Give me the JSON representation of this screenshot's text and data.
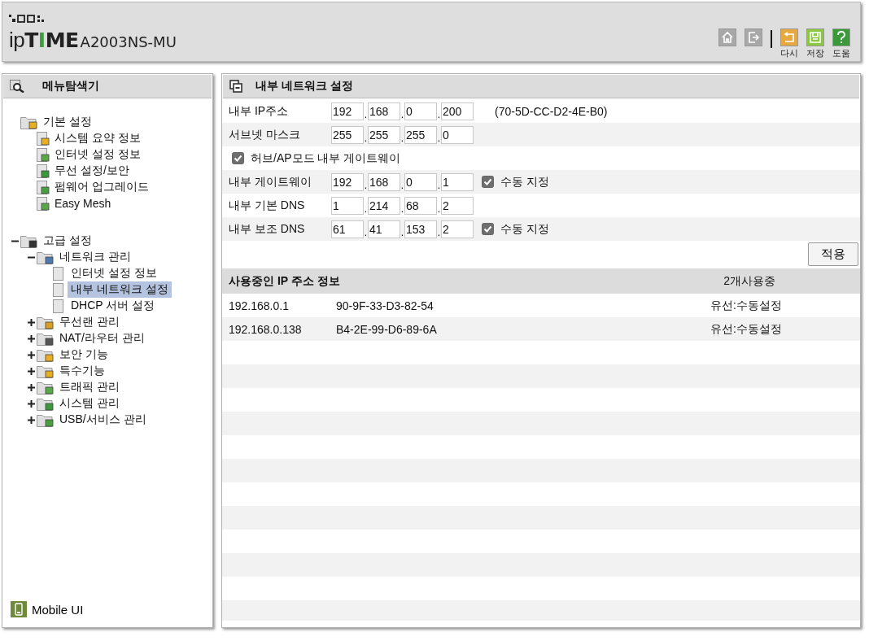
{
  "header": {
    "logo": "ipTIME",
    "model": "A2003NS-MU",
    "actions": [
      {
        "kind": "home"
      },
      {
        "kind": "logout"
      },
      {
        "kind": "undo",
        "label": "다시"
      },
      {
        "kind": "save",
        "label": "저장"
      },
      {
        "kind": "help",
        "label": "도움"
      }
    ]
  },
  "sidebar": {
    "title": "메뉴탐색기",
    "tree": [
      {
        "label": "기본 설정",
        "selected": false,
        "children": [
          {
            "label": "시스템 요약 정보",
            "selected": false
          },
          {
            "label": "인터넷 설정 정보",
            "selected": false
          },
          {
            "label": "무선 설정/보안",
            "selected": false
          },
          {
            "label": "펌웨어 업그레이드",
            "selected": false
          },
          {
            "label": "Easy Mesh",
            "selected": false
          }
        ]
      },
      {
        "label": "고급 설정",
        "selected": false,
        "expanded": true,
        "children": [
          {
            "label": "네트워크 관리",
            "selected": false,
            "expanded": true,
            "children": [
              {
                "label": "인터넷 설정 정보",
                "selected": false
              },
              {
                "label": "내부 네트워크 설정",
                "selected": true
              },
              {
                "label": "DHCP 서버 설정",
                "selected": false
              }
            ]
          },
          {
            "label": "무선랜 관리",
            "selected": false,
            "expanded": false
          },
          {
            "label": "NAT/라우터 관리",
            "selected": false,
            "expanded": false
          },
          {
            "label": "보안 기능",
            "selected": false,
            "expanded": false
          },
          {
            "label": "특수기능",
            "selected": false,
            "expanded": false
          },
          {
            "label": "트래픽 관리",
            "selected": false,
            "expanded": false
          },
          {
            "label": "시스템 관리",
            "selected": false,
            "expanded": false
          },
          {
            "label": "USB/서비스 관리",
            "selected": false,
            "expanded": false
          }
        ]
      }
    ],
    "mobile_link": "Mobile UI"
  },
  "panel": {
    "title": "내부 네트워크 설정",
    "separator": ".",
    "rows": [
      {
        "kind": "ip",
        "label": "내부 IP주소",
        "octets": [
          "192",
          "168",
          "0",
          "200"
        ],
        "note": "(70-5D-CC-D2-4E-B0)"
      },
      {
        "kind": "ip",
        "label": "서브넷 마스크",
        "octets": [
          "255",
          "255",
          "255",
          "0"
        ]
      },
      {
        "kind": "checkbox",
        "label": "허브/AP모드 내부 게이트웨이",
        "checked": true
      },
      {
        "kind": "ip",
        "label": "내부 게이트웨이",
        "octets": [
          "192",
          "168",
          "0",
          "1"
        ],
        "manual": {
          "label": "수동 지정",
          "checked": true
        }
      },
      {
        "kind": "ip",
        "label": "내부 기본 DNS",
        "octets": [
          "1",
          "214",
          "68",
          "2"
        ]
      },
      {
        "kind": "ip",
        "label": "내부 보조 DNS",
        "octets": [
          "61",
          "41",
          "153",
          "2"
        ],
        "manual": {
          "label": "수동 지정",
          "checked": true
        }
      }
    ],
    "apply_button": "적용",
    "table": {
      "title": "사용중인 IP 주소 정보",
      "count": "2개사용중",
      "rows": [
        {
          "ip": "192.168.0.1",
          "mac": "90-9F-33-D3-82-54",
          "type": "유선:수동설정"
        },
        {
          "ip": "192.168.0.138",
          "mac": "B4-2E-99-D6-89-6A",
          "type": "유선:수동설정"
        }
      ]
    }
  }
}
